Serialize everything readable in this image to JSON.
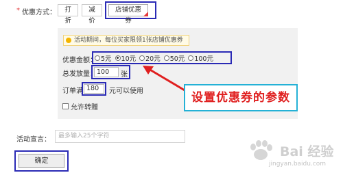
{
  "promo": {
    "required_mark": "*",
    "label": "优惠方式：",
    "tabs": [
      "打折",
      "减价",
      "店铺优惠券"
    ]
  },
  "panel": {
    "notice": "活动期间，每位买家限领1张店铺优惠券",
    "amount_label": "优惠金额：",
    "amounts": [
      "5元",
      "10元",
      "20元",
      "50元",
      "100元"
    ],
    "amount_selected": "10元",
    "quantity_label": "总发放量：",
    "quantity_value": "100",
    "quantity_unit": "张",
    "order_label": "订单满",
    "order_value": "180",
    "order_suffix": "元可以使用",
    "transfer_label": "允许转赠"
  },
  "annotation": {
    "callout": "设置优惠券的参数",
    "arrow_color": "#e02020",
    "box_color": "#2a2ab5"
  },
  "slogan": {
    "label": "活动宣言：",
    "placeholder": "最多输入25个字符"
  },
  "confirm_label": "确定",
  "watermark": {
    "name": "Bai 经验",
    "url": "jingyan.baidu.com"
  }
}
